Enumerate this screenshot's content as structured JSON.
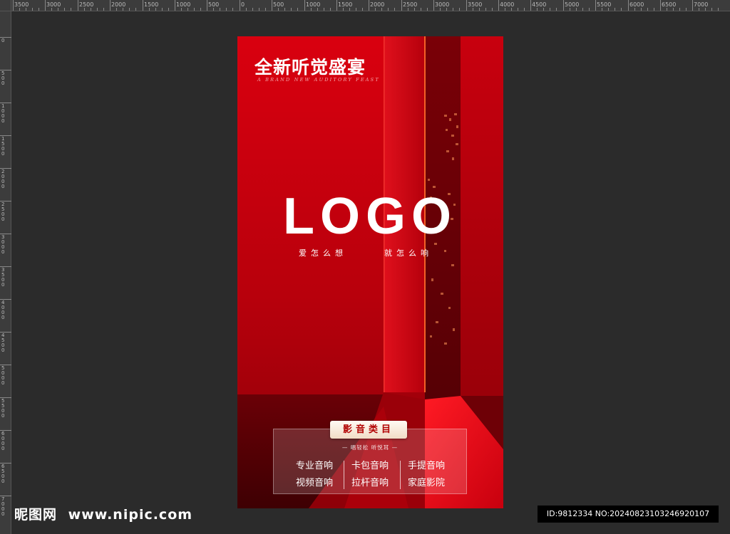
{
  "ruler": {
    "top_ticks": [
      "3500",
      "3000",
      "2500",
      "2000",
      "1500",
      "1000",
      "500",
      "0",
      "500",
      "1000",
      "1500",
      "2000",
      "2500",
      "3000",
      "3500",
      "4000",
      "4500",
      "5000",
      "5500",
      "6000",
      "6500",
      "7000"
    ],
    "left_ticks": [
      "0",
      "500",
      "1000",
      "1500",
      "2000",
      "2500",
      "3000",
      "3500",
      "4000",
      "4500",
      "5000",
      "5500",
      "6000",
      "6500",
      "7000"
    ]
  },
  "poster": {
    "title": "全新听觉盛宴",
    "subtitle": "A BRAND NEW AUDITORY FEAST",
    "logo_text": "LOGO",
    "slogan_left": "爱怎么想",
    "slogan_right": "就怎么响",
    "category": {
      "badge": "影音类目",
      "tagline": "— 唱轻松   听悦耳 —",
      "items": [
        "专业音响",
        "卡包音响",
        "手提音响",
        "视频音响",
        "拉杆音响",
        "家庭影院"
      ]
    },
    "colors": {
      "primary_red": "#d0000f",
      "dark_red": "#5a0006"
    }
  },
  "watermark": {
    "site_name": "昵图网",
    "site_url": "www.nipic.com",
    "id_text": "ID:9812334 NO:20240823103246920107"
  }
}
